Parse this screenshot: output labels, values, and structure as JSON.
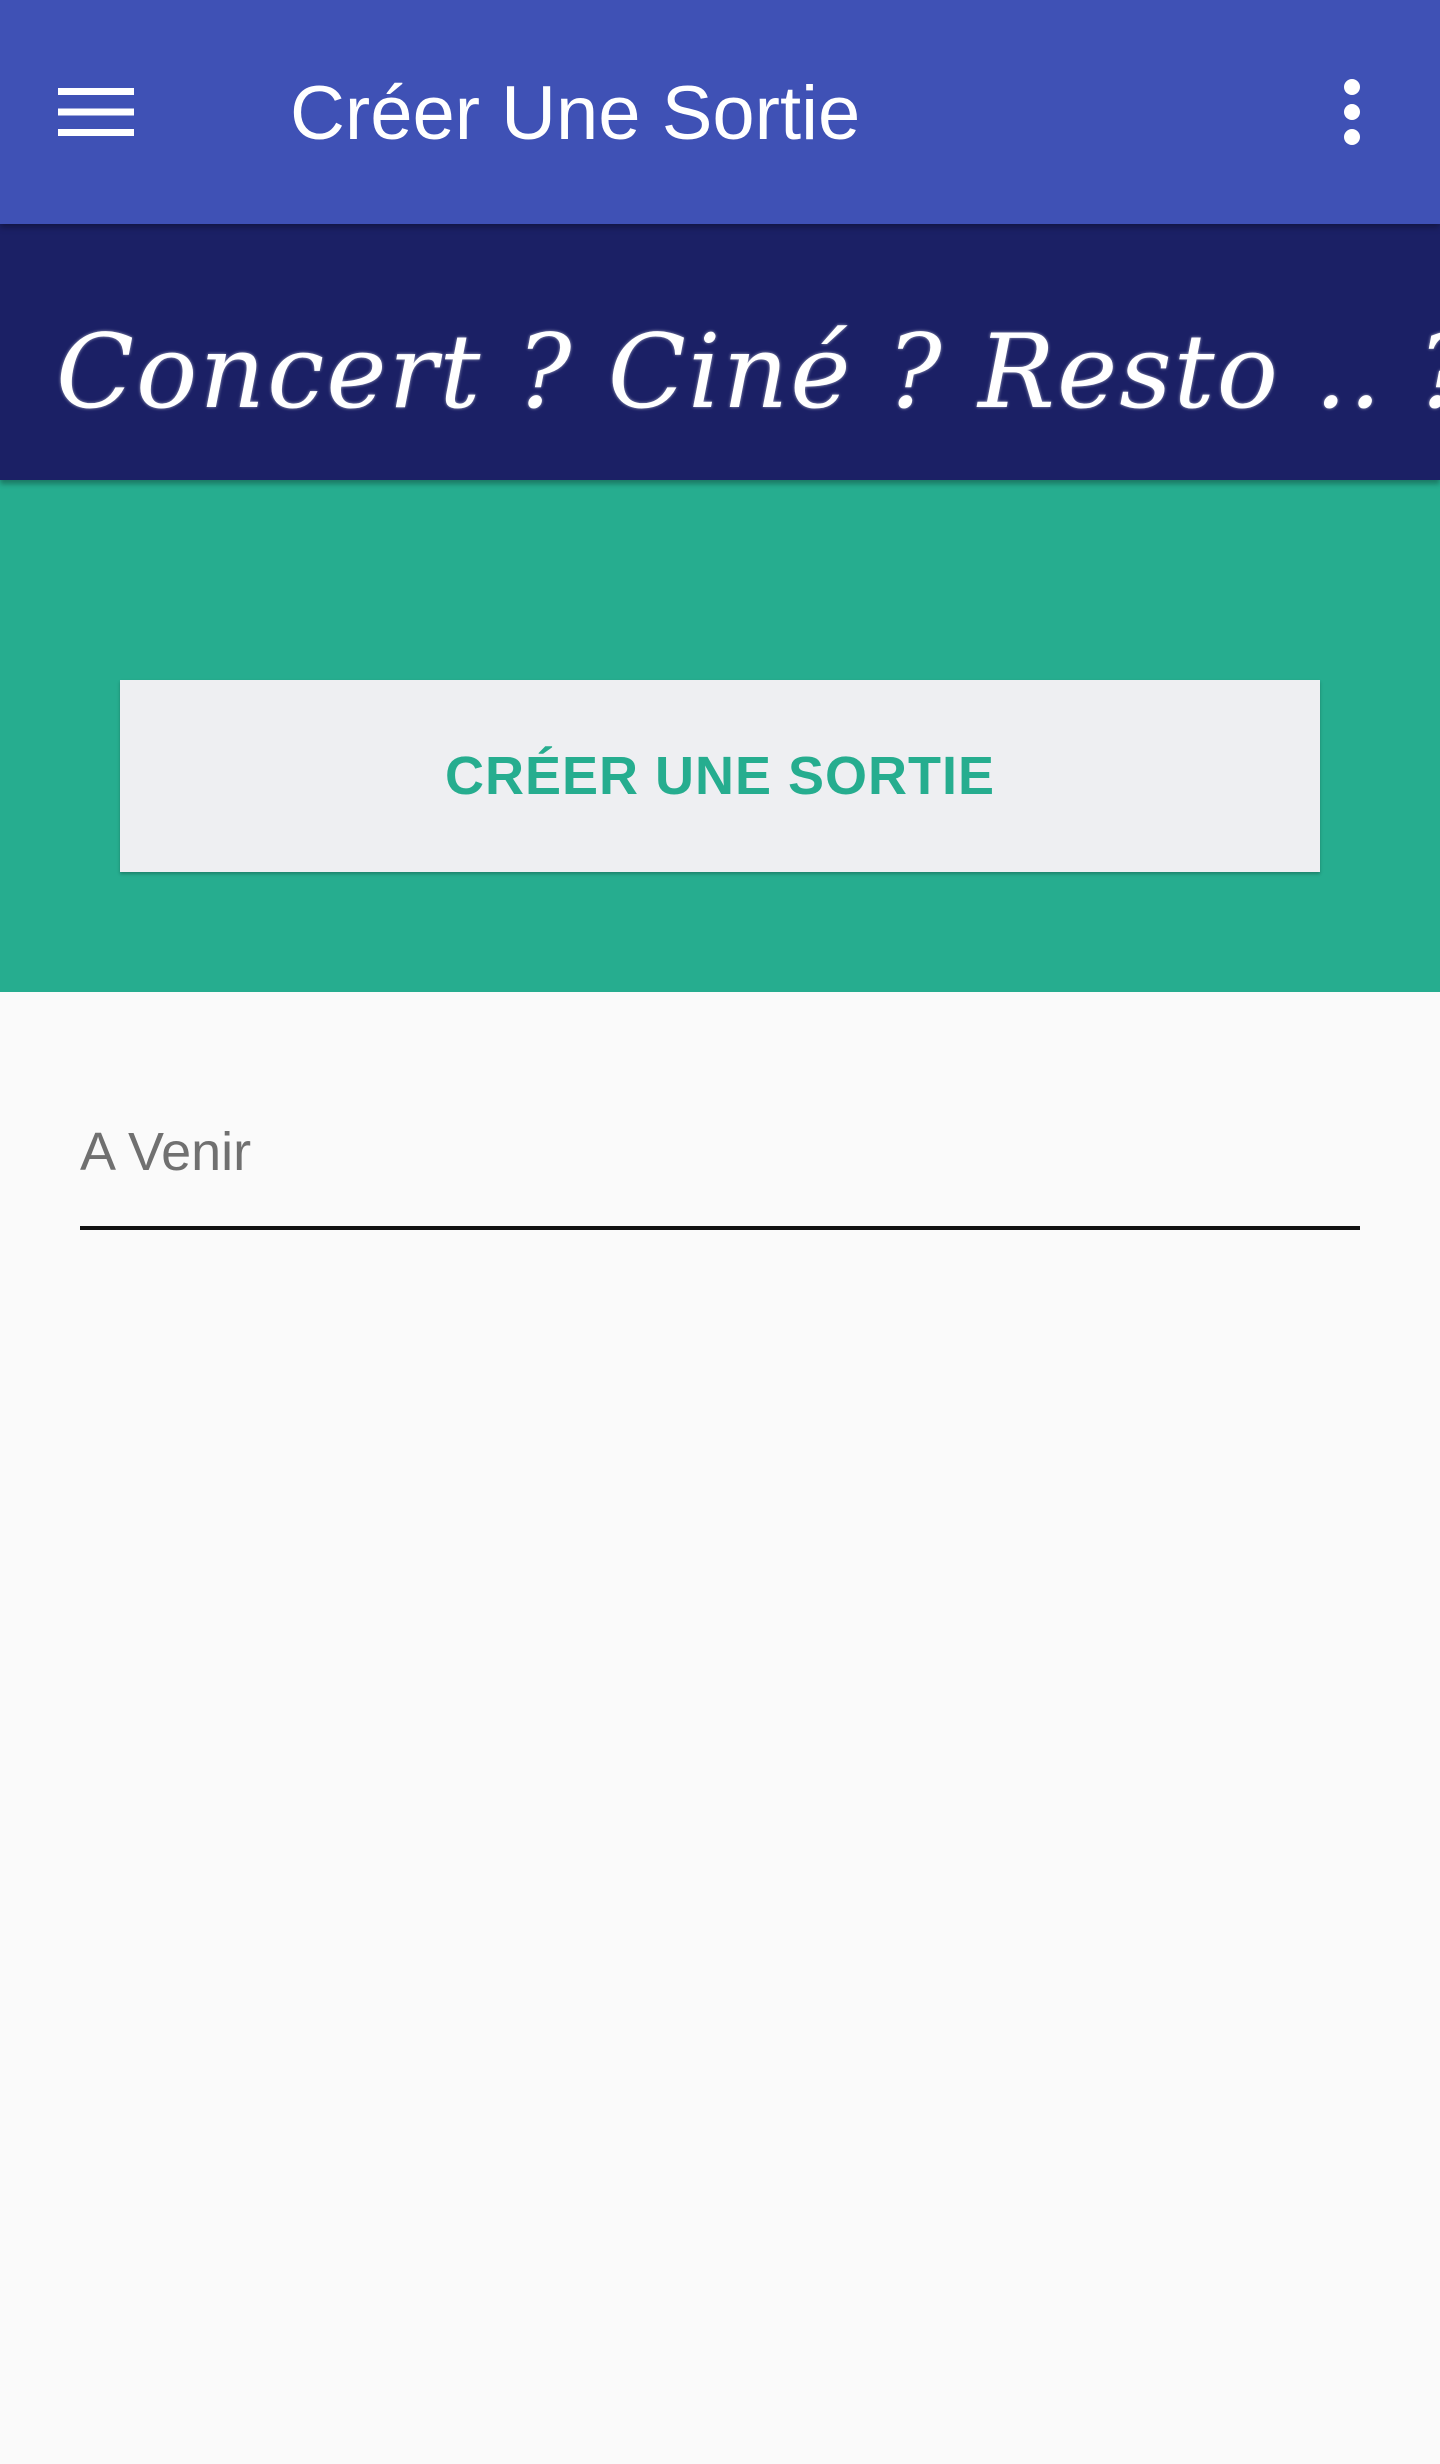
{
  "toolbar": {
    "title": "Créer Une Sortie",
    "menu_icon": "hamburger-menu-icon",
    "overflow_icon": "more-vert-icon",
    "background_color": "#3F51B5"
  },
  "banner": {
    "text": "Concert ? Ciné ? Resto .. ?",
    "background_color": "#1B2065"
  },
  "hero": {
    "background_color": "#26AD8F",
    "create_button_label": "CRÉER UNE SORTIE"
  },
  "filter_field": {
    "value": "",
    "placeholder": "A Venir"
  }
}
